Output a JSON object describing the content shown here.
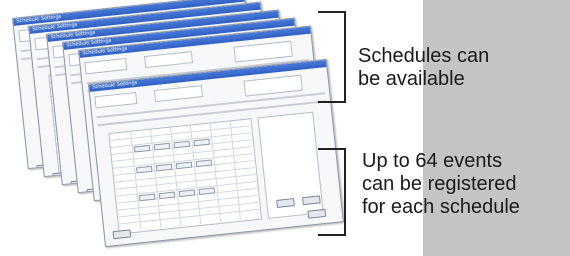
{
  "window_title": "Schedule Settings",
  "stack_count": 6,
  "captions": {
    "top": [
      "Schedules can",
      "be available"
    ],
    "bottom": [
      "Up to 64 events",
      "can be registered",
      "for each schedule"
    ]
  }
}
